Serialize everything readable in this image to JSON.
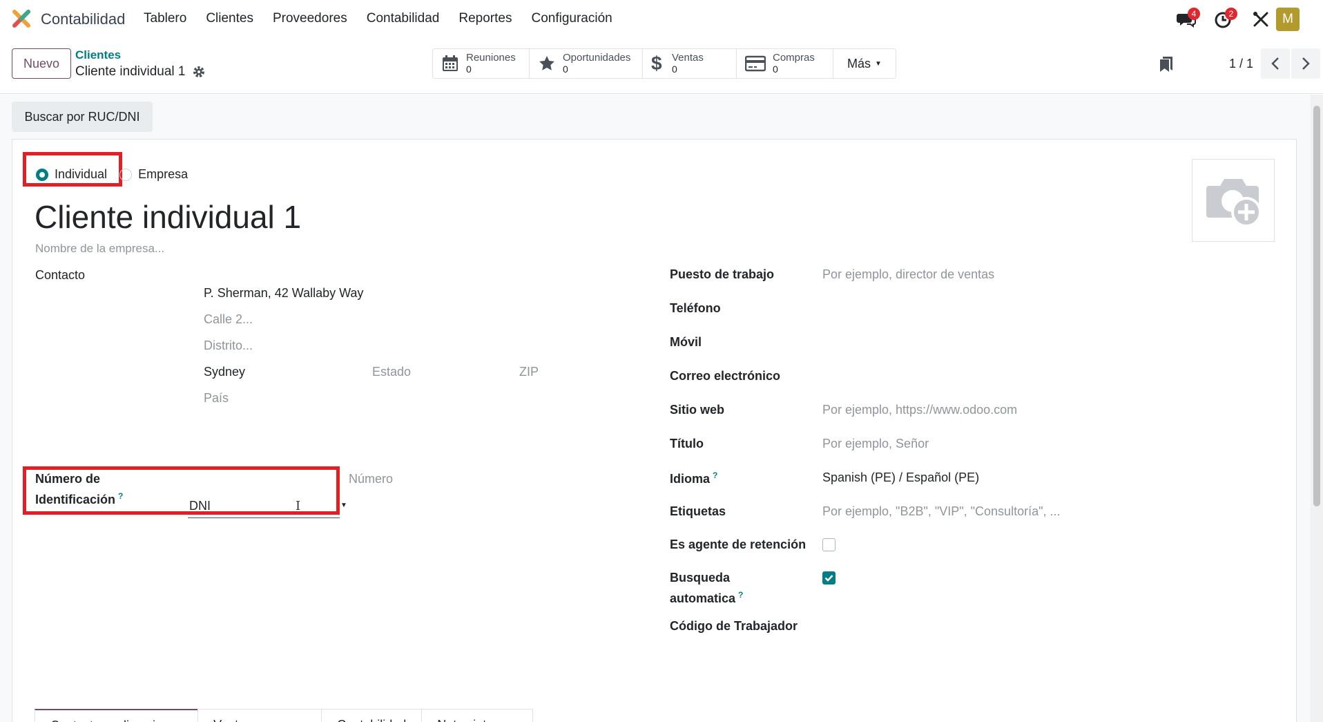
{
  "navbar": {
    "app_name": "Contabilidad",
    "menu": [
      "Tablero",
      "Clientes",
      "Proveedores",
      "Contabilidad",
      "Reportes",
      "Configuración"
    ],
    "chat_badge": "4",
    "activity_badge": "2",
    "avatar_letter": "M"
  },
  "control": {
    "new_label": "Nuevo",
    "breadcrumb": "Clientes",
    "record_title": "Cliente individual 1",
    "smart_buttons": [
      {
        "label": "Reuniones",
        "value": "0",
        "icon": "calendar-icon"
      },
      {
        "label": "Oportunidades",
        "value": "0",
        "icon": "star-icon"
      },
      {
        "label": "Ventas",
        "value": "0",
        "icon": "dollar-icon"
      },
      {
        "label": "Compras",
        "value": "0",
        "icon": "credit-card-icon"
      }
    ],
    "more_label": "Más",
    "pager": "1 / 1"
  },
  "actions": {
    "search_ruc": "Buscar por RUC/DNI"
  },
  "form": {
    "type_individual": "Individual",
    "type_company": "Empresa",
    "partner_name": "Cliente individual 1",
    "company_placeholder": "Nombre de la empresa...",
    "contact_label": "Contacto",
    "street": "P. Sherman, 42 Wallaby Way",
    "street2_placeholder": "Calle 2...",
    "district_placeholder": "Distrito...",
    "city": "Sydney",
    "state_placeholder": "Estado",
    "zip_placeholder": "ZIP",
    "country_placeholder": "País",
    "id_label_1": "Número de",
    "id_label_2": "Identificación",
    "help_mark": "?",
    "id_type": "DNI",
    "id_number_placeholder": "Número",
    "right_fields": {
      "job_label": "Puesto de trabajo",
      "job_placeholder": "Por ejemplo, director de ventas",
      "phone_label": "Teléfono",
      "mobile_label": "Móvil",
      "email_label": "Correo electrónico",
      "website_label": "Sitio web",
      "website_placeholder": "Por ejemplo, https://www.odoo.com",
      "title_label": "Título",
      "title_placeholder": "Por ejemplo, Señor",
      "lang_label": "Idioma",
      "lang_value": "Spanish (PE) / Español (PE)",
      "tags_label": "Etiquetas",
      "tags_placeholder": "Por ejemplo, \"B2B\", \"VIP\", \"Consultoría\", ...",
      "retention_label": "Es agente de retención",
      "auto_search_label_1": "Busqueda",
      "auto_search_label_2": "automatica",
      "worker_code_label": "Código de Trabajador"
    },
    "auto_search_checked": true,
    "retention_checked": false
  },
  "tabs": [
    "Contactos y direcciones",
    "Ventas y compra",
    "Contabilidad",
    "Notas internas"
  ],
  "colors": {
    "primary": "#714b67",
    "teal": "#017e84",
    "highlight": "#e31e24",
    "badge": "#e0272d"
  }
}
